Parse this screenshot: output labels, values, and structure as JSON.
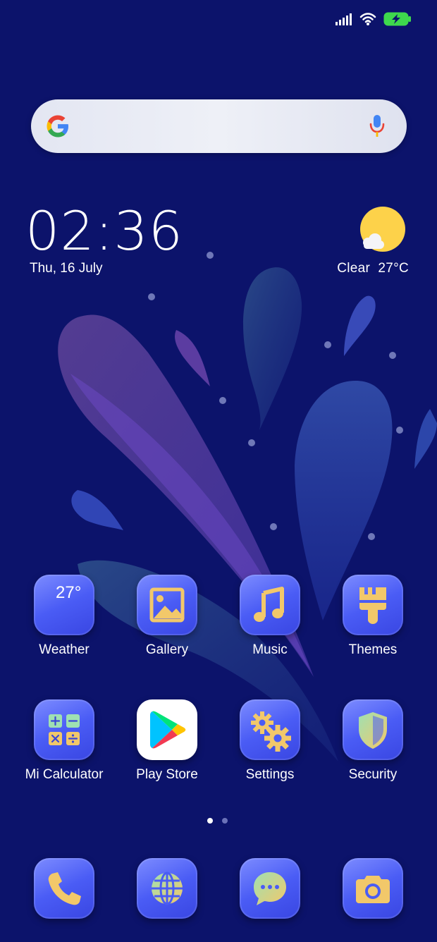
{
  "status_bar": {
    "icons": [
      "signal-icon",
      "wifi-icon",
      "battery-charging-icon"
    ]
  },
  "search": {
    "logo": "google-logo-icon",
    "voice": "mic-icon"
  },
  "clock": {
    "time": "02:36",
    "date": "Thu, 16 July"
  },
  "weather_widget": {
    "condition": "Clear",
    "temperature": "27°C"
  },
  "apps_row1": [
    {
      "label": "Weather",
      "icon": "weather-icon",
      "temp": "27°"
    },
    {
      "label": "Gallery",
      "icon": "gallery-icon"
    },
    {
      "label": "Music",
      "icon": "music-note-icon"
    },
    {
      "label": "Themes",
      "icon": "paintbrush-icon"
    }
  ],
  "apps_row2": [
    {
      "label": "Mi Calculator",
      "icon": "calculator-icon"
    },
    {
      "label": "Play Store",
      "icon": "play-store-icon"
    },
    {
      "label": "Settings",
      "icon": "gears-icon"
    },
    {
      "label": "Security",
      "icon": "shield-icon"
    }
  ],
  "page_indicator": {
    "pages": 2,
    "current": 1
  },
  "dock": [
    {
      "icon": "phone-icon"
    },
    {
      "icon": "browser-globe-icon"
    },
    {
      "icon": "messages-icon"
    },
    {
      "icon": "camera-icon"
    }
  ],
  "colors": {
    "background": "#0c136b",
    "icon_tile": "#4a5cf5",
    "icon_glyph": "#f2c86a"
  }
}
